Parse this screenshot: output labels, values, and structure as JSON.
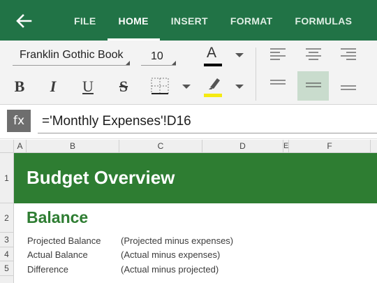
{
  "colors": {
    "brand_green": "#217346",
    "banner_green": "#2e7d32",
    "font_color_bar": "#000000",
    "highlight_bar": "#f5ea12",
    "align_selected": "#c9dccd"
  },
  "topbar": {
    "back_icon": "back-arrow-icon",
    "tabs": [
      {
        "label": "FILE",
        "active": false
      },
      {
        "label": "HOME",
        "active": true
      },
      {
        "label": "INSERT",
        "active": false
      },
      {
        "label": "FORMAT",
        "active": false
      },
      {
        "label": "FORMULAS",
        "active": false
      }
    ]
  },
  "ribbon": {
    "font_name": "Franklin Gothic Book",
    "font_size": "10",
    "font_color_letter": "A",
    "bold": "B",
    "italic": "I",
    "underline": "U",
    "strikethrough": "S",
    "icons": [
      "font-color-icon",
      "borders-icon",
      "highlight-icon",
      "align-left-icon",
      "align-center-icon",
      "align-right-icon",
      "align-top-icon",
      "align-middle-icon",
      "align-bottom-icon"
    ],
    "selected_vertical_align": "middle"
  },
  "formula_bar": {
    "fx_label": "fx",
    "formula": "='Monthly Expenses'!D16"
  },
  "grid": {
    "columns": [
      "A",
      "B",
      "C",
      "D",
      "E",
      "F"
    ],
    "rows": [
      "1",
      "2",
      "3",
      "4",
      "5"
    ],
    "cells": {
      "title": "Budget Overview",
      "balance_heading": "Balance",
      "rows": [
        {
          "label": "Projected Balance",
          "note": "(Projected  minus expenses)"
        },
        {
          "label": "Actual Balance",
          "note": "(Actual  minus expenses)"
        },
        {
          "label": "Difference",
          "note": "(Actual minus projected)"
        }
      ]
    }
  }
}
